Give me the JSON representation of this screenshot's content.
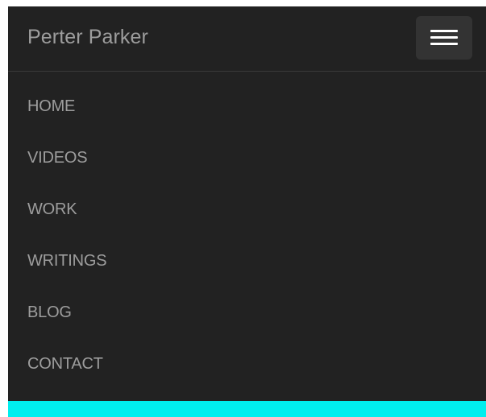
{
  "navbar": {
    "brand": "Perter Parker",
    "toggle_icon": "hamburger-menu-icon"
  },
  "menu": {
    "items": [
      {
        "label": "HOME"
      },
      {
        "label": "VIDEOS"
      },
      {
        "label": "WORK"
      },
      {
        "label": "WRITINGS"
      },
      {
        "label": "BLOG"
      },
      {
        "label": "CONTACT"
      }
    ]
  },
  "colors": {
    "navbar_background": "#222222",
    "text": "#9d9d9d",
    "toggle_background": "#333333",
    "accent": "#00eeee"
  }
}
